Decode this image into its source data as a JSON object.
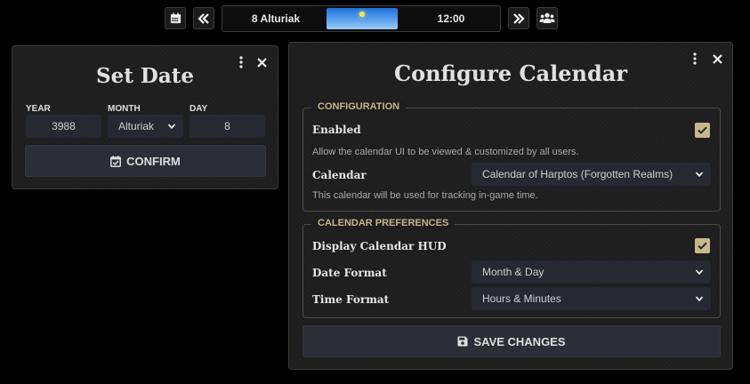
{
  "hud": {
    "date": "8 Alturiak",
    "time": "12:00",
    "sun_progress": 0.5,
    "buttons": {
      "calendar": "calendar-icon",
      "rewind": "rewind-icon",
      "forward": "fast-forward-icon",
      "users": "users-icon"
    }
  },
  "set_date": {
    "title": "Set Date",
    "year_label": "YEAR",
    "year_value": "3988",
    "month_label": "MONTH",
    "month_value": "Alturiak",
    "day_label": "DAY",
    "day_value": "8",
    "confirm_label": "CONFIRM"
  },
  "configure": {
    "title": "Configure Calendar",
    "configuration": {
      "legend": "CONFIGURATION",
      "enabled_label": "Enabled",
      "enabled_checked": true,
      "enabled_hint": "Allow the calendar UI to be viewed & customized by all users.",
      "calendar_label": "Calendar",
      "calendar_value": "Calendar of Harptos (Forgotten Realms)",
      "calendar_hint": "This calendar will be used for tracking in-game time."
    },
    "preferences": {
      "legend": "CALENDAR PREFERENCES",
      "hud_label": "Display Calendar HUD",
      "hud_checked": true,
      "date_format_label": "Date Format",
      "date_format_value": "Month & Day",
      "time_format_label": "Time Format",
      "time_format_value": "Hours & Minutes"
    },
    "save_label": "SAVE CHANGES"
  },
  "colors": {
    "background": "#000000",
    "window": "#1d1d1d",
    "input": "#262932",
    "legend_text": "#c9b48a",
    "checkbox": "#c8b88e"
  }
}
